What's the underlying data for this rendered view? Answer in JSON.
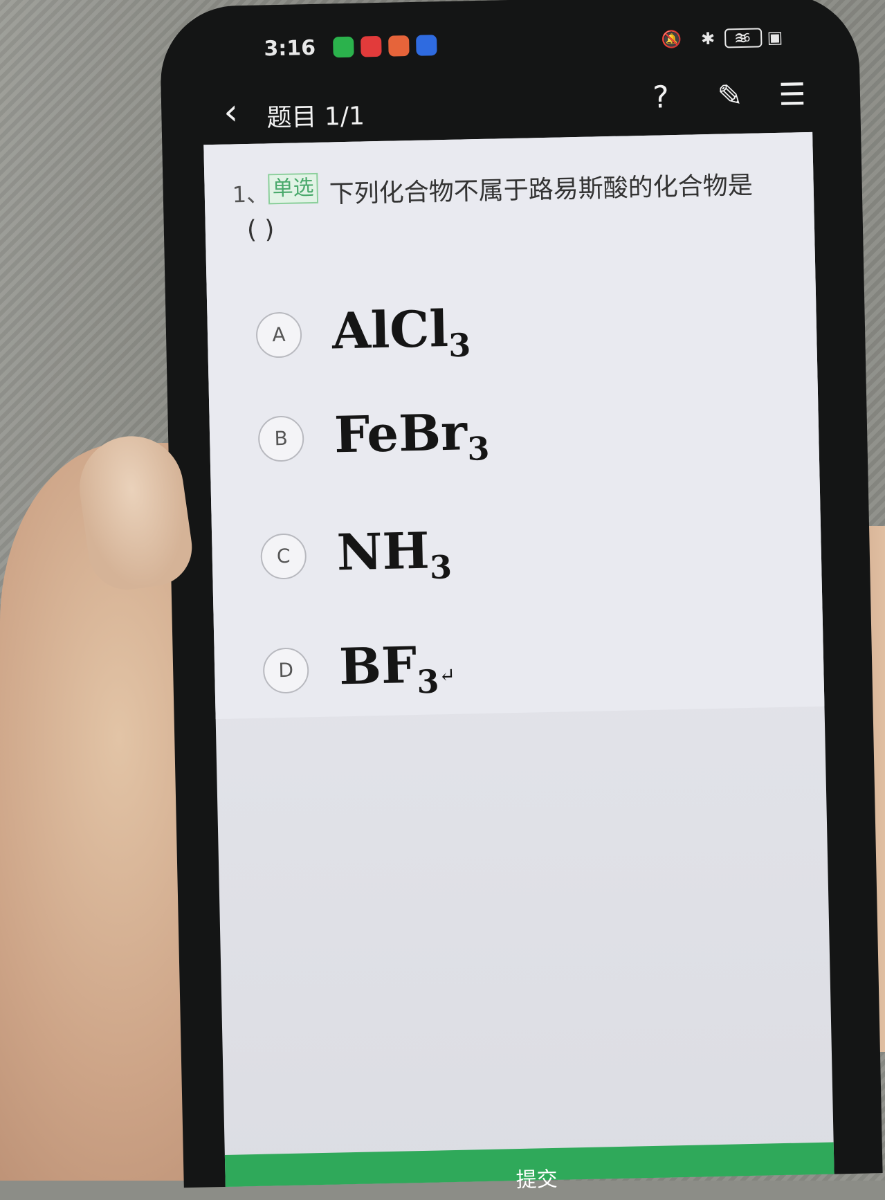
{
  "status_bar": {
    "time": "3:16",
    "icons": "🔕 ✱ ≋ ▣",
    "battery": "36"
  },
  "nav": {
    "back_icon": "‹",
    "title": "题目 1/1",
    "help_icon": "?",
    "note_icon": "✎",
    "list_icon": "☰"
  },
  "question": {
    "number": "1、",
    "tag": "单选",
    "text": "下列化合物不属于路易斯酸的化合物是",
    "blank": "(      )"
  },
  "options": [
    {
      "letter": "A",
      "formula": "AlCl",
      "subscript": "3"
    },
    {
      "letter": "B",
      "formula": "FeBr",
      "subscript": "3"
    },
    {
      "letter": "C",
      "formula": "NH",
      "subscript": "3"
    },
    {
      "letter": "D",
      "formula": "BF",
      "subscript": "3",
      "suffix": "↵"
    }
  ],
  "submit": {
    "label": "提交"
  },
  "colors": {
    "accent": "#2fa95a",
    "tag": "#4aa96c",
    "screen": "#e9eaf0"
  }
}
